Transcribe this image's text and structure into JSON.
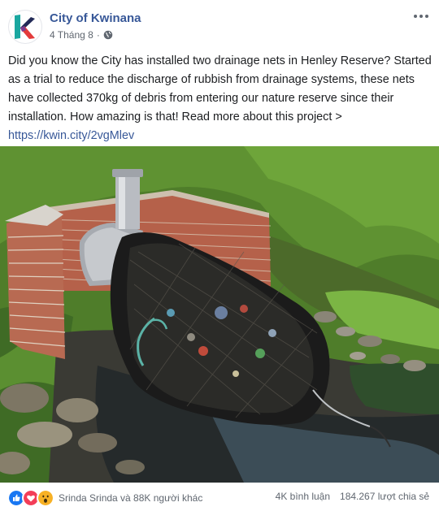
{
  "post": {
    "page_name": "City of Kwinana",
    "date": "4 Tháng 8",
    "dot": "·",
    "text": "Did you know the City has installed two drainage nets in Henley Reserve? Started as a trial to reduce the discharge of rubbish from drainage systems, these nets have collected 370kg of debris from entering our nature reserve since their installation. How amazing is that! Read more about this project > ",
    "link": "https://kwin.city/2vgMlev"
  },
  "footer": {
    "reaction_names": "Srinda Srinda và 88K người khác",
    "comments": "4K bình luận",
    "shares": "184.267 lượt chia sẻ"
  },
  "colors": {
    "link": "#385898",
    "like": "#1877f2",
    "love": "#f33e58",
    "wow": "#f7b125"
  }
}
